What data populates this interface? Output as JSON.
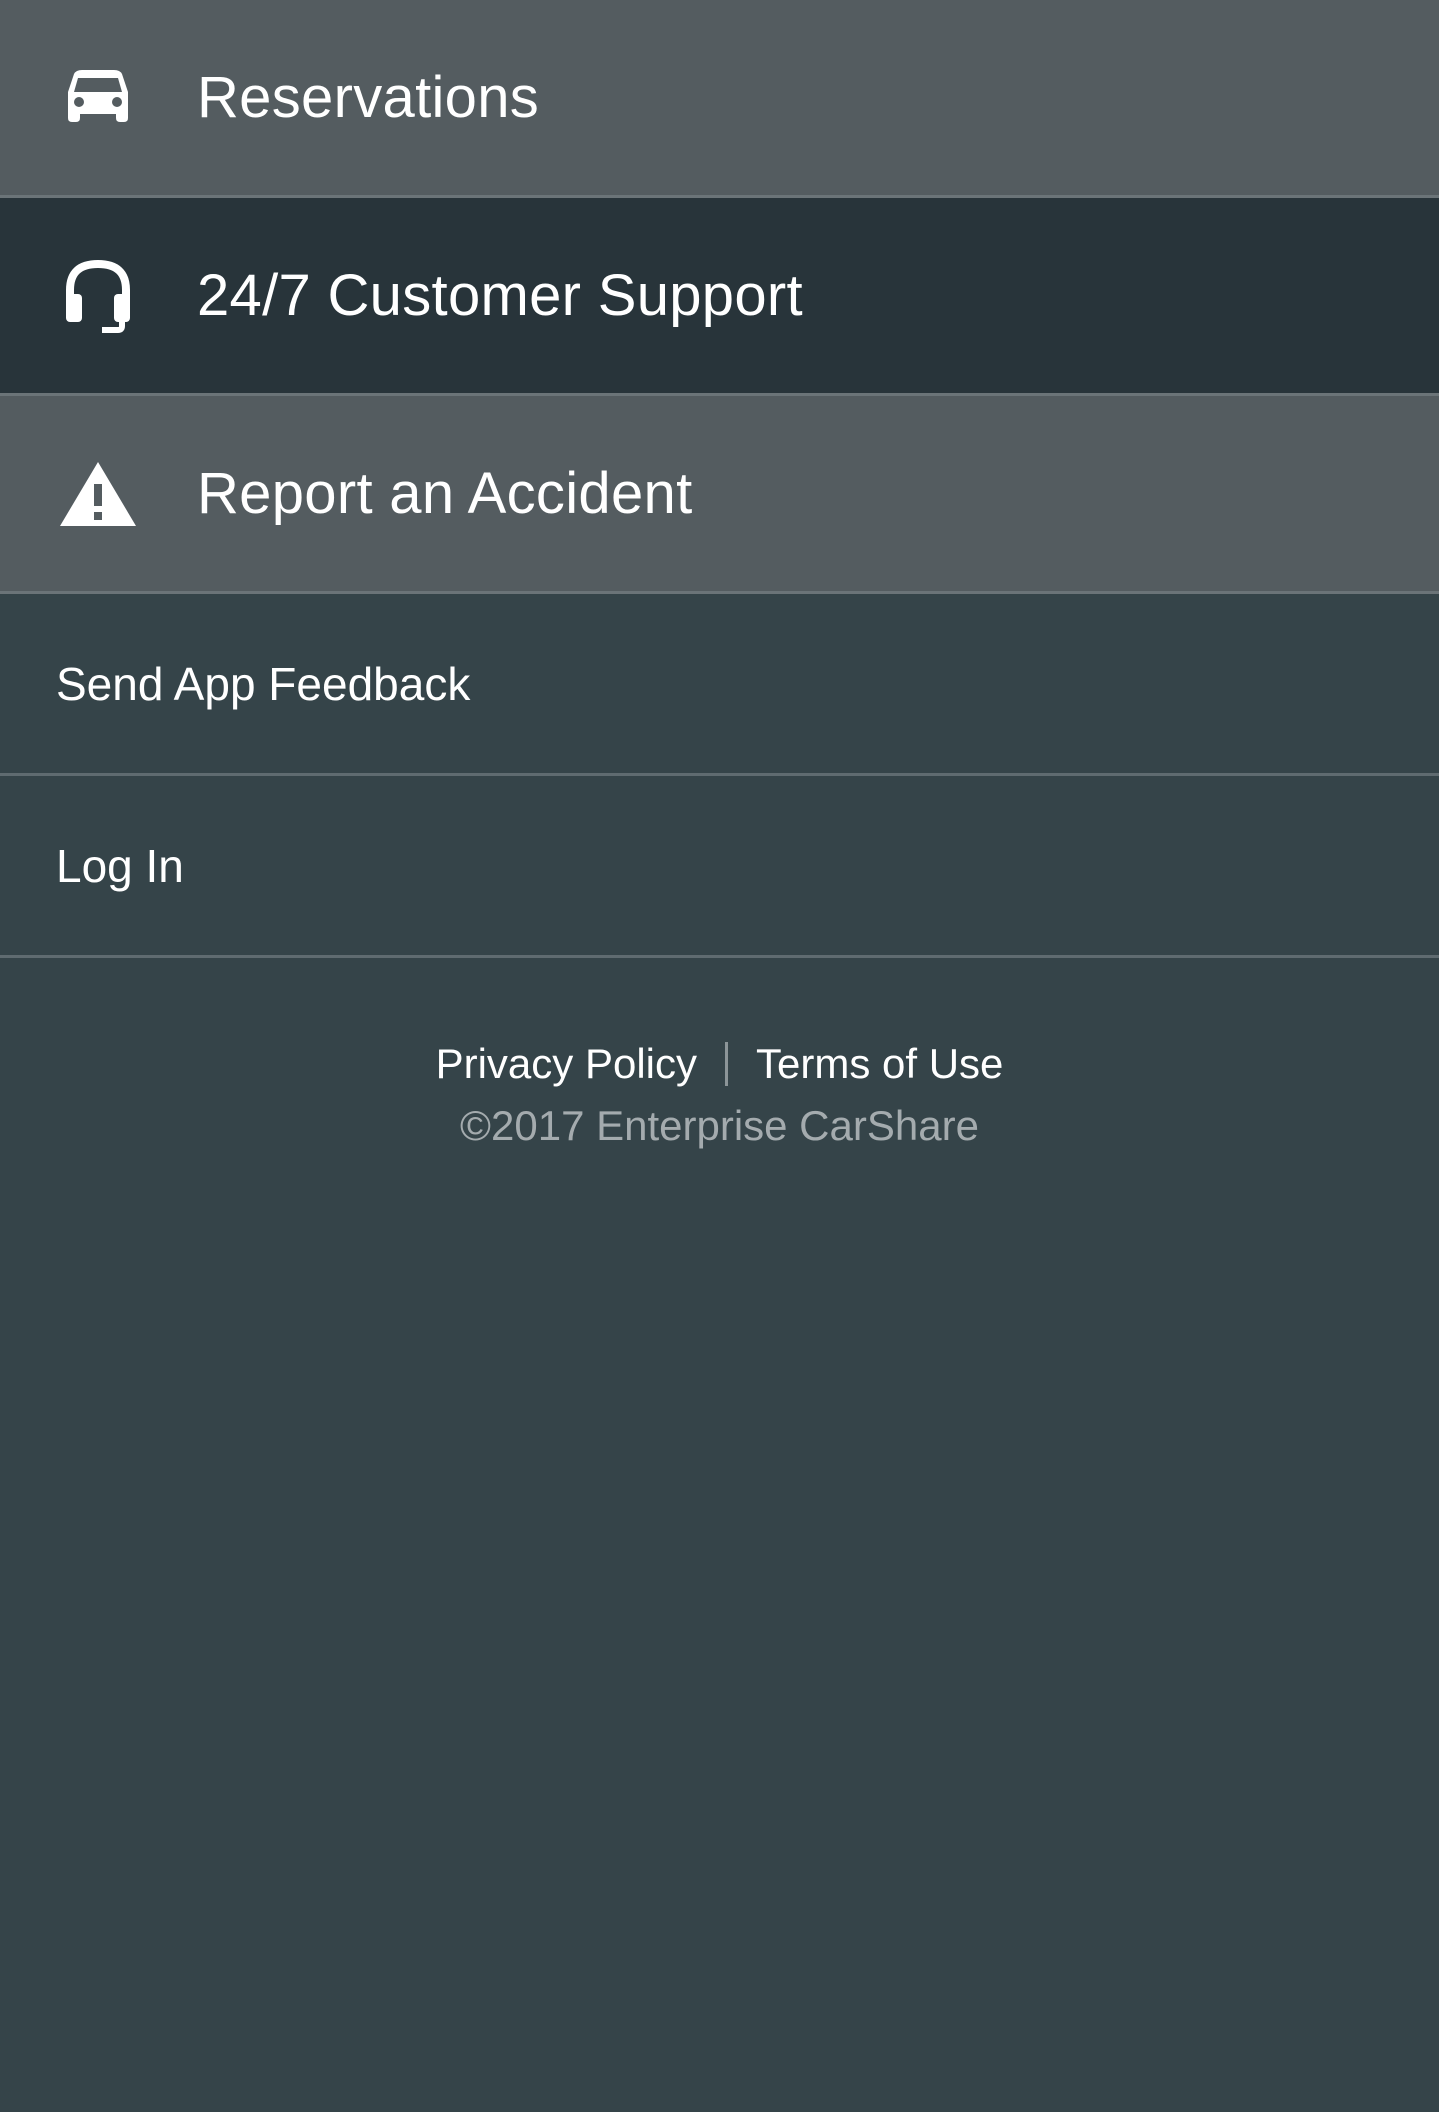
{
  "menu": {
    "items": [
      {
        "label": "Reservations",
        "icon": "car-icon"
      },
      {
        "label": "24/7 Customer Support",
        "icon": "headset-icon"
      },
      {
        "label": "Report an Accident",
        "icon": "warning-icon"
      }
    ],
    "secondary": [
      {
        "label": "Send App Feedback"
      },
      {
        "label": "Log In"
      }
    ]
  },
  "footer": {
    "privacy": "Privacy Policy",
    "terms": "Terms of Use",
    "copyright": "©2017 Enterprise CarShare"
  },
  "colors": {
    "background": "#354449",
    "item_light": "#545c60",
    "item_dark": "#28343a",
    "text": "#ffffff",
    "muted_text": "#a4abae"
  }
}
